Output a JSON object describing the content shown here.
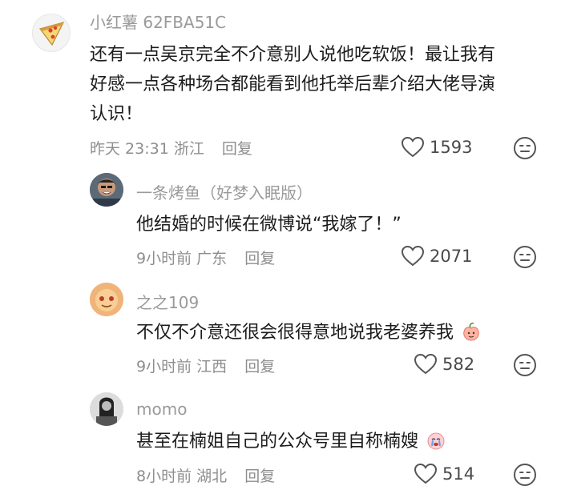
{
  "comments": [
    {
      "username": "小红薯 62FBA51C",
      "text_lines": [
        "还有一点吴京完全不介意别人说他吃软饭！最让我有",
        "好感一点各种场合都能看到他托举后辈介绍大佬导演",
        "认识！"
      ],
      "time": "昨天 23:31",
      "location": "浙江",
      "reply_label": "回复",
      "likes": "1593",
      "avatar_icon": "pizza-icon"
    },
    {
      "username": "一条烤鱼（好梦入眠版）",
      "text": "他结婚的时候在微博说“我嫁了！”",
      "time": "9小时前",
      "location": "广东",
      "reply_label": "回复",
      "likes": "2071",
      "avatar_icon": "photo-avatar"
    },
    {
      "username": "之之109",
      "text": "不仅不介意还很会很得意地说我老婆养我",
      "time": "9小时前",
      "location": "江西",
      "reply_label": "回复",
      "likes": "582",
      "avatar_icon": "sticker-avatar",
      "trailing_emoji": "peach-emoji"
    },
    {
      "username": "momo",
      "text": "甚至在楠姐自己的公众号里自称楠嫂",
      "time": "8小时前",
      "location": "湖北",
      "reply_label": "回复",
      "likes": "514",
      "avatar_icon": "photo-avatar",
      "trailing_emoji": "crying-emoji"
    }
  ],
  "icons": {
    "like": "heart-outline-icon",
    "react": "neutral-face-icon"
  },
  "colors": {
    "background": "#ffffff",
    "username": "#9a9a9a",
    "meta": "#8e8e8e",
    "text": "#1c1c1c"
  }
}
